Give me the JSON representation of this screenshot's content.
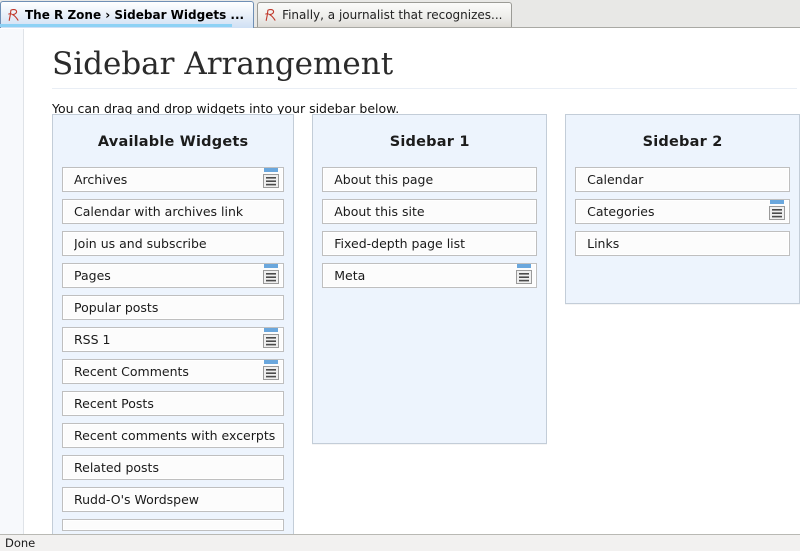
{
  "browser": {
    "tabs": [
      {
        "title": "The R Zone › Sidebar Widgets ...",
        "favicon": "r-zone-favicon",
        "active": true
      },
      {
        "title": "Finally, a journalist that recognizes...",
        "favicon": "r-zone-favicon",
        "active": false
      }
    ],
    "status": "Done"
  },
  "page": {
    "title": "Sidebar Arrangement",
    "intro": "You can drag and drop widgets into your sidebar below."
  },
  "colors": {
    "panel_bg": "#edf4fd",
    "panel_border": "#c3cdd8",
    "widget_bg": "#fcfcfc",
    "widget_border": "#bfbfbf",
    "icon_titlebar": "#6aa7dd",
    "tab_accent": "#7ec8f0",
    "favicon_red": "#c0392b"
  },
  "columns": [
    {
      "id": "available-widgets",
      "title": "Available Widgets",
      "widgets": [
        {
          "label": "Archives",
          "config": true
        },
        {
          "label": "Calendar with archives link",
          "config": false
        },
        {
          "label": "Join us and subscribe",
          "config": false
        },
        {
          "label": "Pages",
          "config": true
        },
        {
          "label": "Popular posts",
          "config": false
        },
        {
          "label": "RSS 1",
          "config": true
        },
        {
          "label": "Recent Comments",
          "config": true
        },
        {
          "label": "Recent Posts",
          "config": false
        },
        {
          "label": "Recent comments with excerpts",
          "config": false
        },
        {
          "label": "Related posts",
          "config": false
        },
        {
          "label": "Rudd-O's Wordspew",
          "config": false
        },
        {
          "label": "",
          "config": false,
          "partial": true
        }
      ]
    },
    {
      "id": "sidebar-1",
      "title": "Sidebar 1",
      "widgets": [
        {
          "label": "About this page",
          "config": false
        },
        {
          "label": "About this site",
          "config": false
        },
        {
          "label": "Fixed-depth page list",
          "config": false
        },
        {
          "label": "Meta",
          "config": true
        }
      ]
    },
    {
      "id": "sidebar-2",
      "title": "Sidebar 2",
      "widgets": [
        {
          "label": "Calendar",
          "config": false
        },
        {
          "label": "Categories",
          "config": true
        },
        {
          "label": "Links",
          "config": false
        }
      ]
    }
  ],
  "icons": {
    "config": "widget-config-icon",
    "favicon": "r-zone-favicon"
  }
}
